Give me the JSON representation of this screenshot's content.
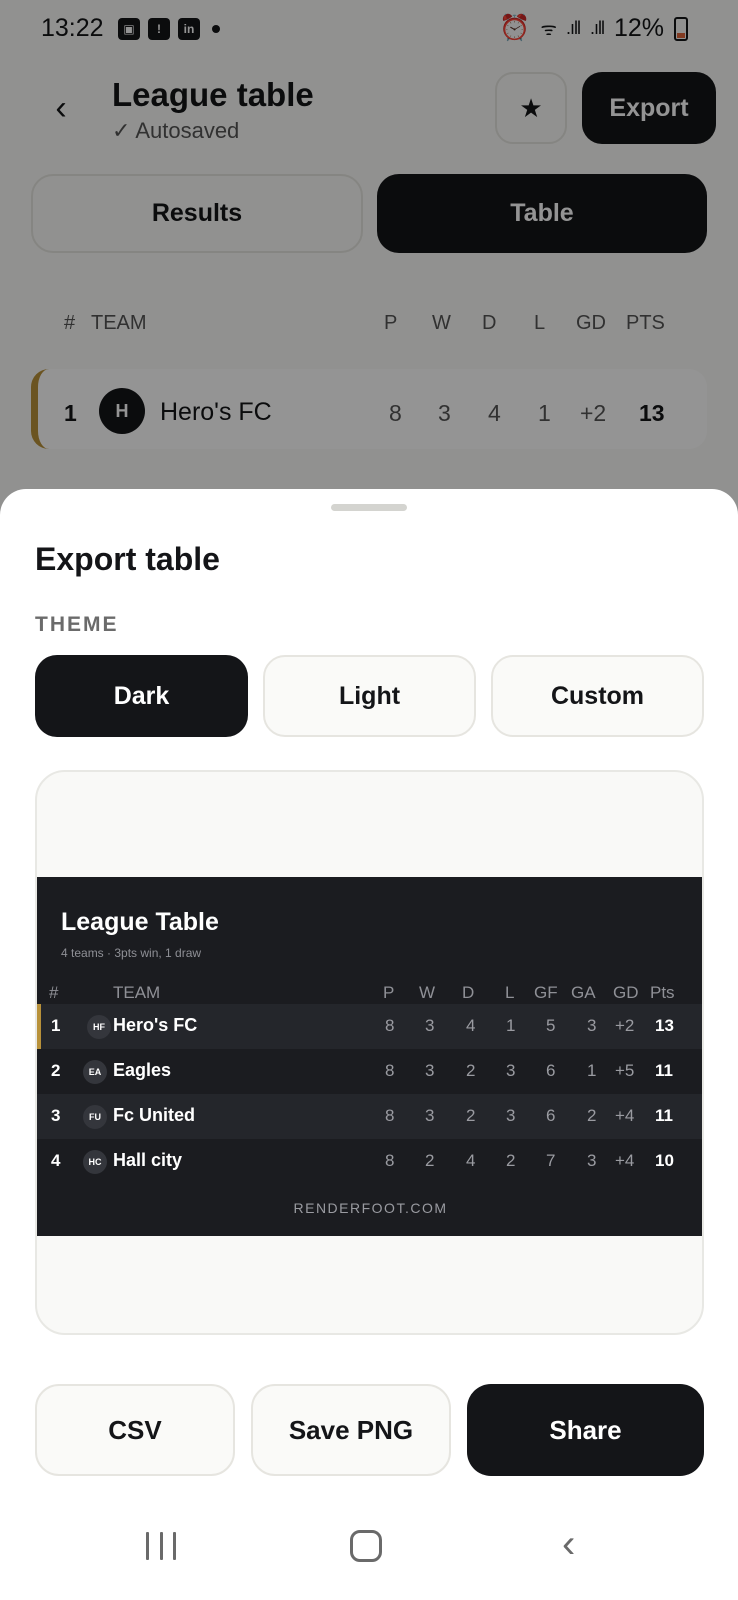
{
  "status_bar": {
    "time": "13:22",
    "battery": "12%",
    "left_icons": [
      "gallery-icon",
      "alert-icon",
      "linkedin-icon"
    ],
    "right_icons": [
      "alarm-icon",
      "wifi-icon",
      "signal-icon",
      "signal-icon"
    ]
  },
  "header": {
    "back_icon": "‹",
    "title": "League table",
    "subtitle": "✓ Autosaved",
    "star_icon": "★",
    "export_label": "Export"
  },
  "tabs": [
    {
      "label": "Results",
      "active": false
    },
    {
      "label": "Table",
      "active": true
    }
  ],
  "league_table": {
    "columns": [
      "#",
      "TEAM",
      "P",
      "W",
      "D",
      "L",
      "GD",
      "PTS"
    ],
    "rows": [
      {
        "rank": "1",
        "badge": "H",
        "team": "Hero's FC",
        "p": "8",
        "w": "3",
        "d": "4",
        "l": "1",
        "gd": "+2",
        "pts": "13"
      }
    ]
  },
  "export_sheet": {
    "title": "Export table",
    "theme_label": "THEME",
    "themes": [
      {
        "label": "Dark",
        "selected": true
      },
      {
        "label": "Light",
        "selected": false
      },
      {
        "label": "Custom",
        "selected": false
      }
    ],
    "preview": {
      "title": "League Table",
      "subtitle": "4 teams · 3pts win, 1 draw",
      "columns": [
        "#",
        "TEAM",
        "P",
        "W",
        "D",
        "L",
        "GF",
        "GA",
        "GD",
        "Pts"
      ],
      "rows": [
        {
          "rank": "1",
          "badge": "HF",
          "team": "Hero's FC",
          "p": "8",
          "w": "3",
          "d": "4",
          "l": "1",
          "gf": "5",
          "ga": "3",
          "gd": "+2",
          "pts": "13"
        },
        {
          "rank": "2",
          "badge": "EA",
          "team": "Eagles",
          "p": "8",
          "w": "3",
          "d": "2",
          "l": "3",
          "gf": "6",
          "ga": "1",
          "gd": "+5",
          "pts": "11"
        },
        {
          "rank": "3",
          "badge": "FU",
          "team": "Fc United",
          "p": "8",
          "w": "3",
          "d": "2",
          "l": "3",
          "gf": "6",
          "ga": "2",
          "gd": "+4",
          "pts": "11"
        },
        {
          "rank": "4",
          "badge": "HC",
          "team": "Hall city",
          "p": "8",
          "w": "2",
          "d": "4",
          "l": "2",
          "gf": "7",
          "ga": "3",
          "gd": "+4",
          "pts": "10"
        }
      ],
      "footer": "RENDERFOOT.COM"
    },
    "actions": {
      "csv": "CSV",
      "save_png": "Save PNG",
      "share": "Share"
    }
  },
  "colors": {
    "dark": "#141518",
    "accent_gold": "#b8913a",
    "preview_bg": "#1b1c20"
  }
}
